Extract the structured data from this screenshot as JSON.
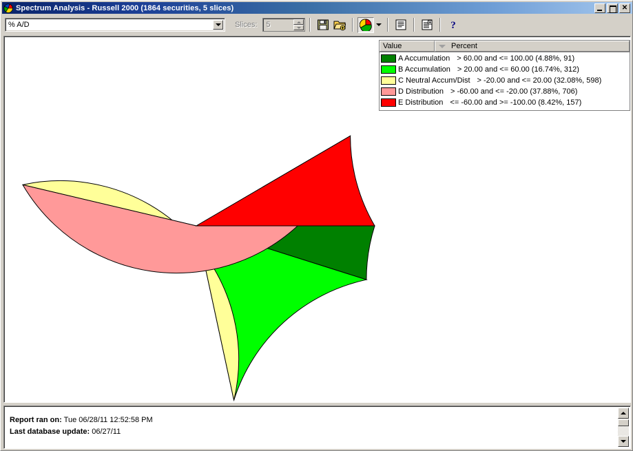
{
  "window": {
    "title": "Spectrum Analysis - Russell 2000 (1864 securities, 5 slices)",
    "icon": "pie-chart-icon",
    "minimize_label": "_",
    "maximize_label": "",
    "close_label": "✕"
  },
  "toolbar": {
    "indicator_combo": {
      "value": "% A/D",
      "dropdown_icon": "chevron-down-icon"
    },
    "slices_label": "Slices:",
    "slices_value": "5",
    "buttons": [
      {
        "name": "save-button",
        "icon": "floppy-disk-icon"
      },
      {
        "name": "open-add-button",
        "icon": "folder-add-icon"
      },
      {
        "name": "pie-chart-view-button",
        "icon": "pie-chart-icon"
      },
      {
        "name": "chart-type-dropdown",
        "icon": "chevron-down-icon"
      },
      {
        "name": "list-view-button",
        "icon": "list-icon"
      },
      {
        "name": "report-view-button",
        "icon": "report-add-icon"
      },
      {
        "name": "help-button",
        "icon": "question-mark-icon"
      }
    ]
  },
  "legend": {
    "columns": [
      "Value",
      "Percent"
    ],
    "sort_indicator": "sort-descending-icon",
    "rows": [
      {
        "color": "#008000",
        "label": "A Accumulation",
        "range": "> 60.00 and <= 100.00 (4.88%, 91)"
      },
      {
        "color": "#00ff00",
        "label": "B Accumulation",
        "range": "> 20.00 and <= 60.00 (16.74%, 312)"
      },
      {
        "color": "#ffff99",
        "label": "C Neutral Accum/Dist",
        "range": "> -20.00 and <= 20.00 (32.08%, 598)"
      },
      {
        "color": "#ff9999",
        "label": "D Distribution",
        "range": "> -60.00 and <= -20.00 (37.88%, 706)"
      },
      {
        "color": "#ff0000",
        "label": "E Distribution",
        "range": "<= -60.00 and >= -100.00 (8.42%, 157)"
      }
    ]
  },
  "report": {
    "ran_on_label": "Report ran on:",
    "ran_on_value": "Tue 06/28/11 12:52:58 PM",
    "db_update_label": "Last database update:",
    "db_update_value": "06/27/11"
  },
  "chart_data": {
    "type": "pie",
    "title": "Spectrum Analysis - Russell 2000",
    "center": [
      280,
      328
    ],
    "radius": 259,
    "start_angle": 0,
    "direction": "counterclockwise",
    "total_count": 1864,
    "slices": [
      {
        "label": "A Accumulation",
        "percent": 4.88,
        "count": 91,
        "color": "#008000",
        "range": "> 60.00 and <= 100.00"
      },
      {
        "label": "B Accumulation",
        "percent": 16.74,
        "count": 312,
        "color": "#00ff00",
        "range": "> 20.00 and <= 60.00"
      },
      {
        "label": "C Neutral Accum/Dist",
        "percent": 32.08,
        "count": 598,
        "color": "#ffff99",
        "range": "> -20.00 and <= 20.00"
      },
      {
        "label": "D Distribution",
        "percent": 37.88,
        "count": 706,
        "color": "#ff9999",
        "range": "> -60.00 and <= -20.00"
      },
      {
        "label": "E Distribution",
        "percent": 8.42,
        "count": 157,
        "color": "#ff0000",
        "range": "<= -60.00 and >= -100.00"
      }
    ],
    "legend_position": "top-right",
    "grid": false
  }
}
